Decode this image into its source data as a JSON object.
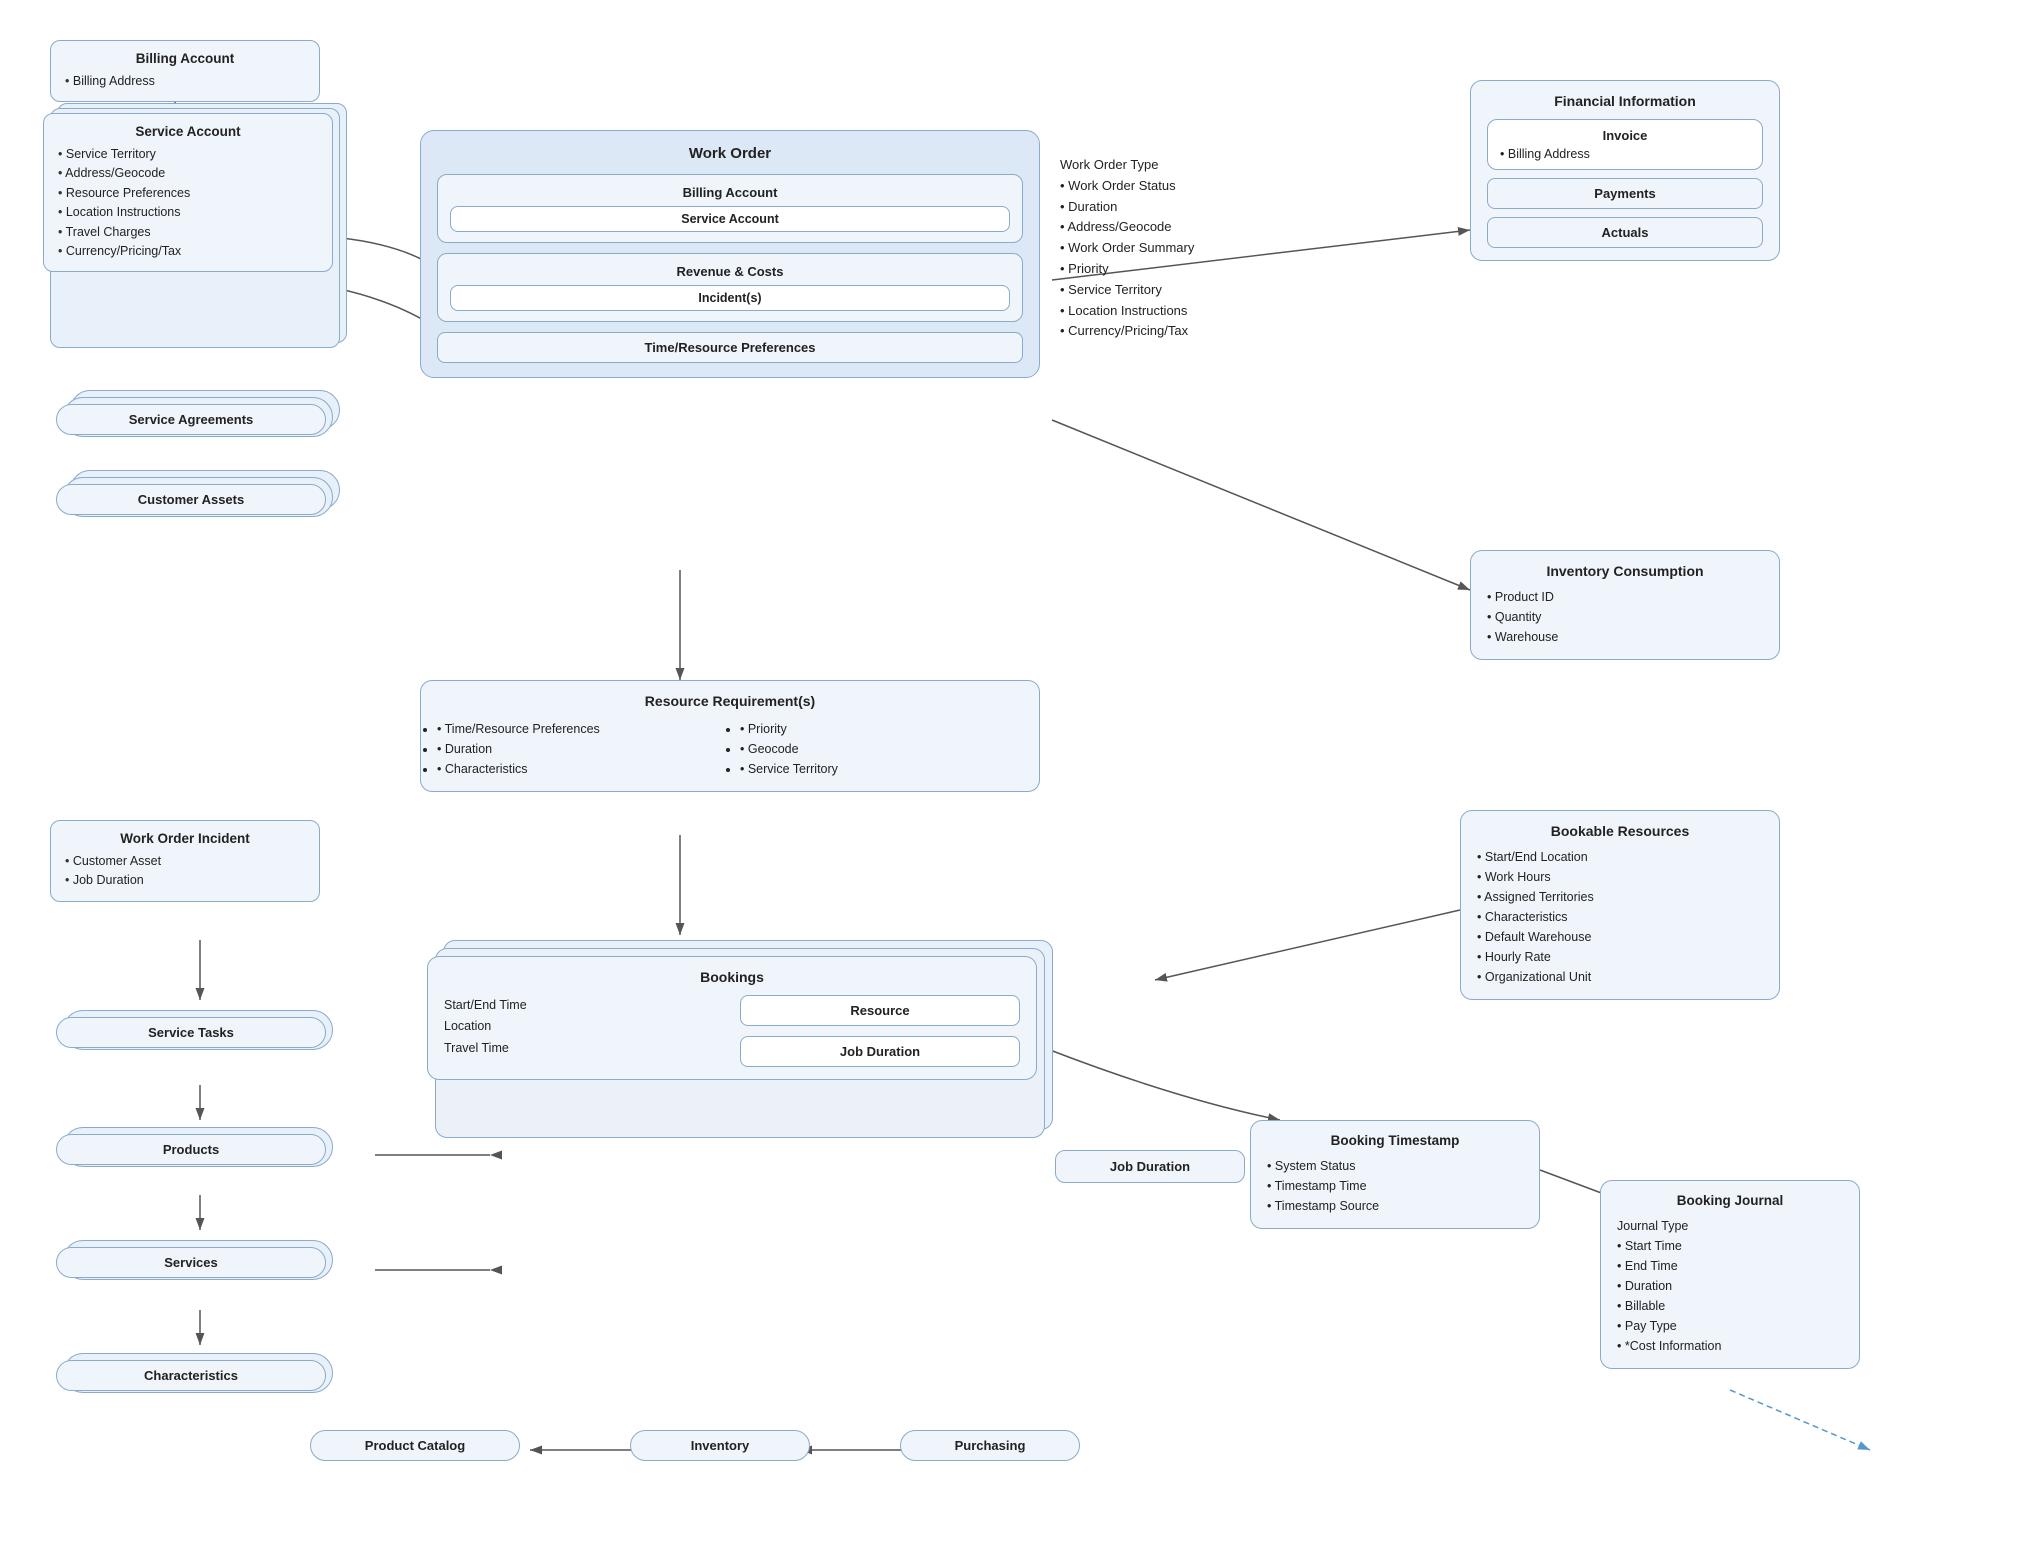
{
  "billing_account_top": {
    "title": "Billing Account",
    "items": [
      "Billing Address"
    ]
  },
  "service_account": {
    "title": "Service Account",
    "items": [
      "Service Territory",
      "Address/Geocode",
      "Resource Preferences",
      "Location Instructions",
      "Travel Charges",
      "Currency/Pricing/Tax"
    ]
  },
  "service_agreements": {
    "label": "Service Agreements"
  },
  "customer_assets": {
    "label": "Customer Assets"
  },
  "work_order_incident": {
    "title": "Work Order Incident",
    "items": [
      "Customer Asset",
      "Job Duration"
    ]
  },
  "service_tasks": {
    "label": "Service Tasks"
  },
  "products": {
    "label": "Products"
  },
  "services": {
    "label": "Services"
  },
  "characteristics_left": {
    "label": "Characteristics"
  },
  "product_catalog": {
    "label": "Product Catalog"
  },
  "inventory_bottom": {
    "label": "Inventory"
  },
  "purchasing": {
    "label": "Purchasing"
  },
  "work_order_outer": {
    "title": "Work Order",
    "billing_account_inner": "Billing Account",
    "service_account_inner": "Service Account",
    "revenue_costs_inner": "Revenue & Costs",
    "incidents_inner": "Incident(s)",
    "time_resource_inner": "Time/Resource Preferences",
    "items": [
      "Work Order Type",
      "Work Order Status",
      "Duration",
      "Address/Geocode",
      "Work Order Summary",
      "Priority",
      "Service Territory",
      "Location Instructions",
      "Currency/Pricing/Tax"
    ]
  },
  "resource_requirements": {
    "title": "Resource Requirement(s)",
    "items_left": [
      "Time/Resource Preferences",
      "Duration",
      "Characteristics"
    ],
    "items_right": [
      "Priority",
      "Geocode",
      "Service Territory"
    ]
  },
  "bookings": {
    "title": "Bookings",
    "left_items": [
      "Start/End Time",
      "Location",
      "Travel Time"
    ],
    "resource_label": "Resource",
    "job_duration_label": "Job Duration"
  },
  "financial_information": {
    "title": "Financial Information",
    "invoice_label": "Invoice",
    "invoice_items": [
      "Billing Address"
    ],
    "payments_label": "Payments",
    "actuals_label": "Actuals"
  },
  "inventory_consumption": {
    "title": "Inventory Consumption",
    "items": [
      "Product ID",
      "Quantity",
      "Warehouse"
    ]
  },
  "bookable_resources": {
    "title": "Bookable Resources",
    "items": [
      "Start/End Location",
      "Work Hours",
      "Assigned Territories",
      "Characteristics",
      "Default Warehouse",
      "Hourly Rate",
      "Organizational Unit"
    ]
  },
  "booking_timestamp": {
    "title": "Booking Timestamp",
    "items": [
      "System Status",
      "Timestamp Time",
      "Timestamp Source"
    ]
  },
  "booking_journal": {
    "title": "Booking Journal",
    "items": [
      "Journal Type",
      "Start Time",
      "End Time",
      "Duration",
      "Billable",
      "Pay Type",
      "*Cost Information"
    ]
  }
}
